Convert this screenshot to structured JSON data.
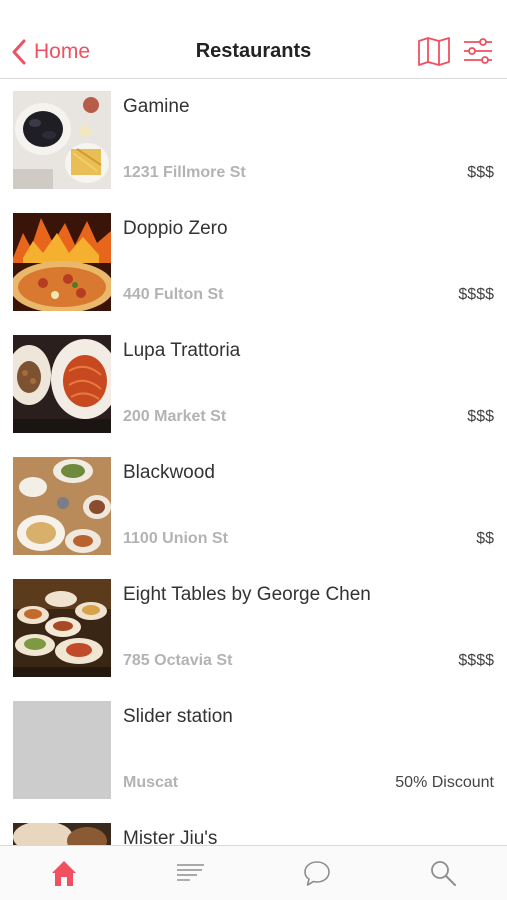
{
  "header": {
    "back_label": "Home",
    "title": "Restaurants"
  },
  "restaurants": [
    {
      "name": "Gamine",
      "address": "1231 Fillmore St",
      "price": "$$$"
    },
    {
      "name": "Doppio Zero",
      "address": "440 Fulton St",
      "price": "$$$$"
    },
    {
      "name": "Lupa Trattoria",
      "address": "200 Market St",
      "price": "$$$"
    },
    {
      "name": "Blackwood",
      "address": "1100 Union St",
      "price": "$$"
    },
    {
      "name": "Eight Tables by George Chen",
      "address": "785 Octavia St",
      "price": "$$$$"
    },
    {
      "name": "Slider station",
      "address": "Muscat",
      "price": "50% Discount"
    },
    {
      "name": "Mister Jiu's",
      "address": "",
      "price": ""
    }
  ],
  "tabbar": {
    "active": "home",
    "tabs": [
      "home-icon",
      "list-icon",
      "chat-icon",
      "search-icon"
    ]
  },
  "colors": {
    "accent": "#f0505f",
    "muted_text": "#b3b3b3"
  }
}
